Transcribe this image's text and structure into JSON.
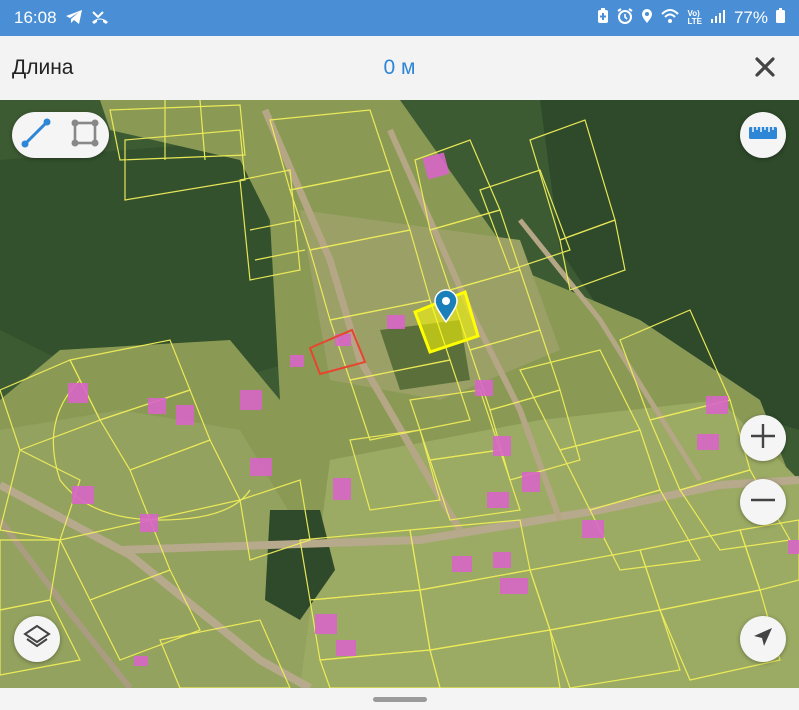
{
  "status_bar": {
    "time": "16:08",
    "battery": "77%",
    "left_icons": [
      "telegram-icon",
      "missed-call-icon"
    ],
    "right_icons": [
      "battery-saver-icon",
      "alarm-icon",
      "location-icon",
      "wifi-icon",
      "volte-icon",
      "signal-icon",
      "battery-icon"
    ]
  },
  "toolbar": {
    "title": "Длина",
    "measurement_value": "0 м",
    "close_icon": "close-icon"
  },
  "map": {
    "tools": [
      "line-measure-icon",
      "area-measure-icon"
    ],
    "ruler_icon": "ruler-icon",
    "zoom_in_icon": "plus-icon",
    "zoom_out_icon": "minus-icon",
    "layers_icon": "layers-icon",
    "locate_icon": "navigation-arrow-icon",
    "marker_icon": "map-pin-icon",
    "colors": {
      "parcel_outline": "#f1ee5a",
      "selected_parcel": "#ffff00",
      "building": "#d966c8",
      "highlighted_parcel_outline": "#e8452e",
      "accent": "#2d86d6"
    }
  }
}
